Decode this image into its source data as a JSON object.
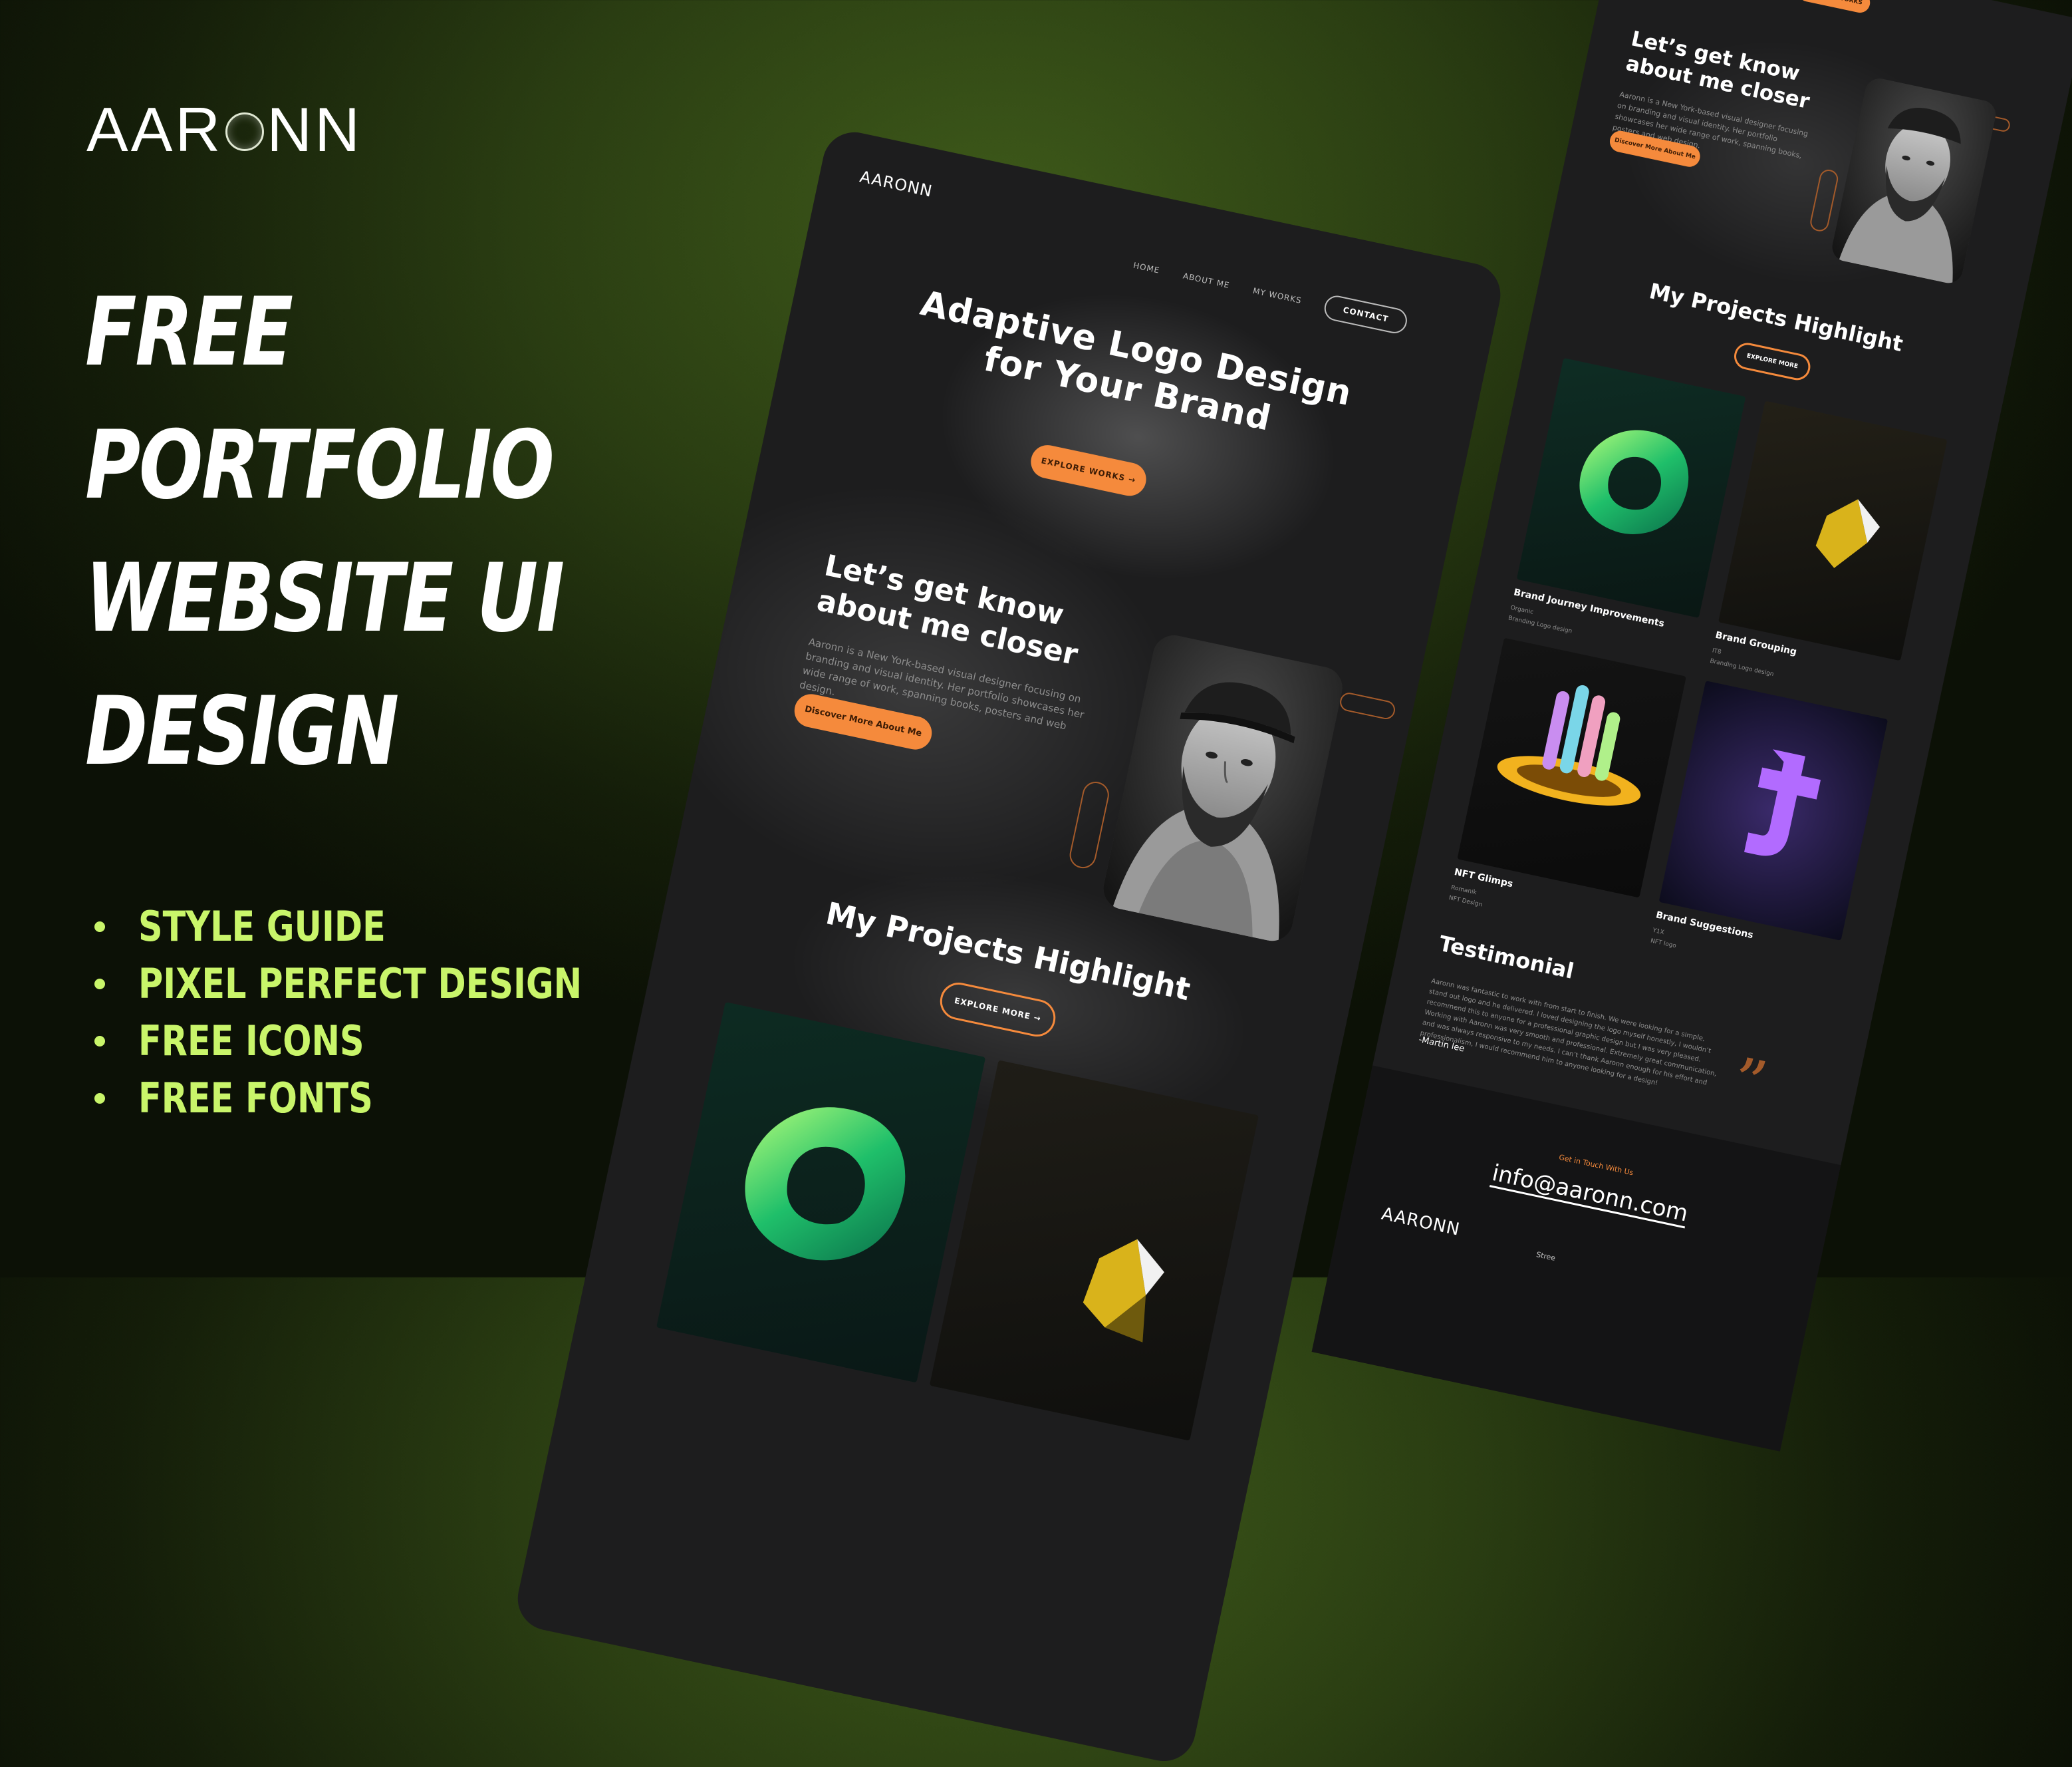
{
  "promo": {
    "logo_left": "AAR",
    "logo_right": "NN",
    "headline": [
      "FREE",
      "PORTFOLIO",
      "WEBSITE UI",
      "DESIGN"
    ],
    "features": [
      "STYLE GUIDE",
      "PIXEL PERFECT DESIGN",
      "FREE ICONS",
      "FREE FONTS"
    ],
    "accent_color": "#c9f56a"
  },
  "main_mockup": {
    "logo": "AARONN",
    "nav": [
      "HOME",
      "ABOUT ME",
      "MY WORKS"
    ],
    "contact_label": "CONTACT",
    "hero_title_line1": "Adaptive Logo Design",
    "hero_title_line2": "for Your Brand",
    "hero_button": "EXPLORE WORKS",
    "about_title_line1": "Let’s get know",
    "about_title_line2": "about me closer",
    "about_body": "Aaronn is a New York-based visual designer focusing on branding and visual identity. Her portfolio showcases her wide range of work, spanning books, posters and web design.",
    "about_button": "Discover More About Me",
    "projects_title": "My Projects Highlight",
    "projects_button": "EXPLORE MORE",
    "accent_color": "#f58a3c"
  },
  "side_mockup": {
    "top_button": "EXPLORE WORKS",
    "about_title_line1": "Let’s get know",
    "about_title_line2": "about me closer",
    "about_body": "Aaronn is a New York-based visual designer focusing on branding and visual identity. Her portfolio showcases her wide range of work, spanning books, posters and web design.",
    "about_button": "Discover More About Me",
    "projects_title": "My Projects Highlight",
    "projects_button": "EXPLORE MORE",
    "projects": [
      {
        "title": "Brand Journey Improvements",
        "client": "Organic",
        "tags": "Branding  Logo design"
      },
      {
        "title": "Brand Grouping",
        "client": "IT8",
        "tags": "Branding  Logo design"
      },
      {
        "title": "NFT Glimps",
        "client": "Romanik",
        "tags": "NFT Design"
      },
      {
        "title": "Brand Suggestions",
        "client": "Y1X",
        "tags": "NFT logo"
      }
    ],
    "testimonial_title": "Testimonial",
    "testimonial_body": "Aaronn was fantastic to work with from start to finish. We were looking for a simple, stand out logo and he delivered. I loved designing the logo myself honestly, I wouldn’t recommend this to anyone for a professional graphic design but I was very pleased. Working with Aaronn was very smooth and professional. Extremely great communication, and was always responsive to my needs. I can’t thank Aaronn enough for his effort and professionalism, I would recommend him to anyone looking for a design!",
    "testimonial_author": "-Martin lee",
    "get_in_touch": "Get in Touch With Us",
    "email": "info@aaronn.com",
    "footer_logo": "AARONN",
    "footer_col": "Stree"
  }
}
